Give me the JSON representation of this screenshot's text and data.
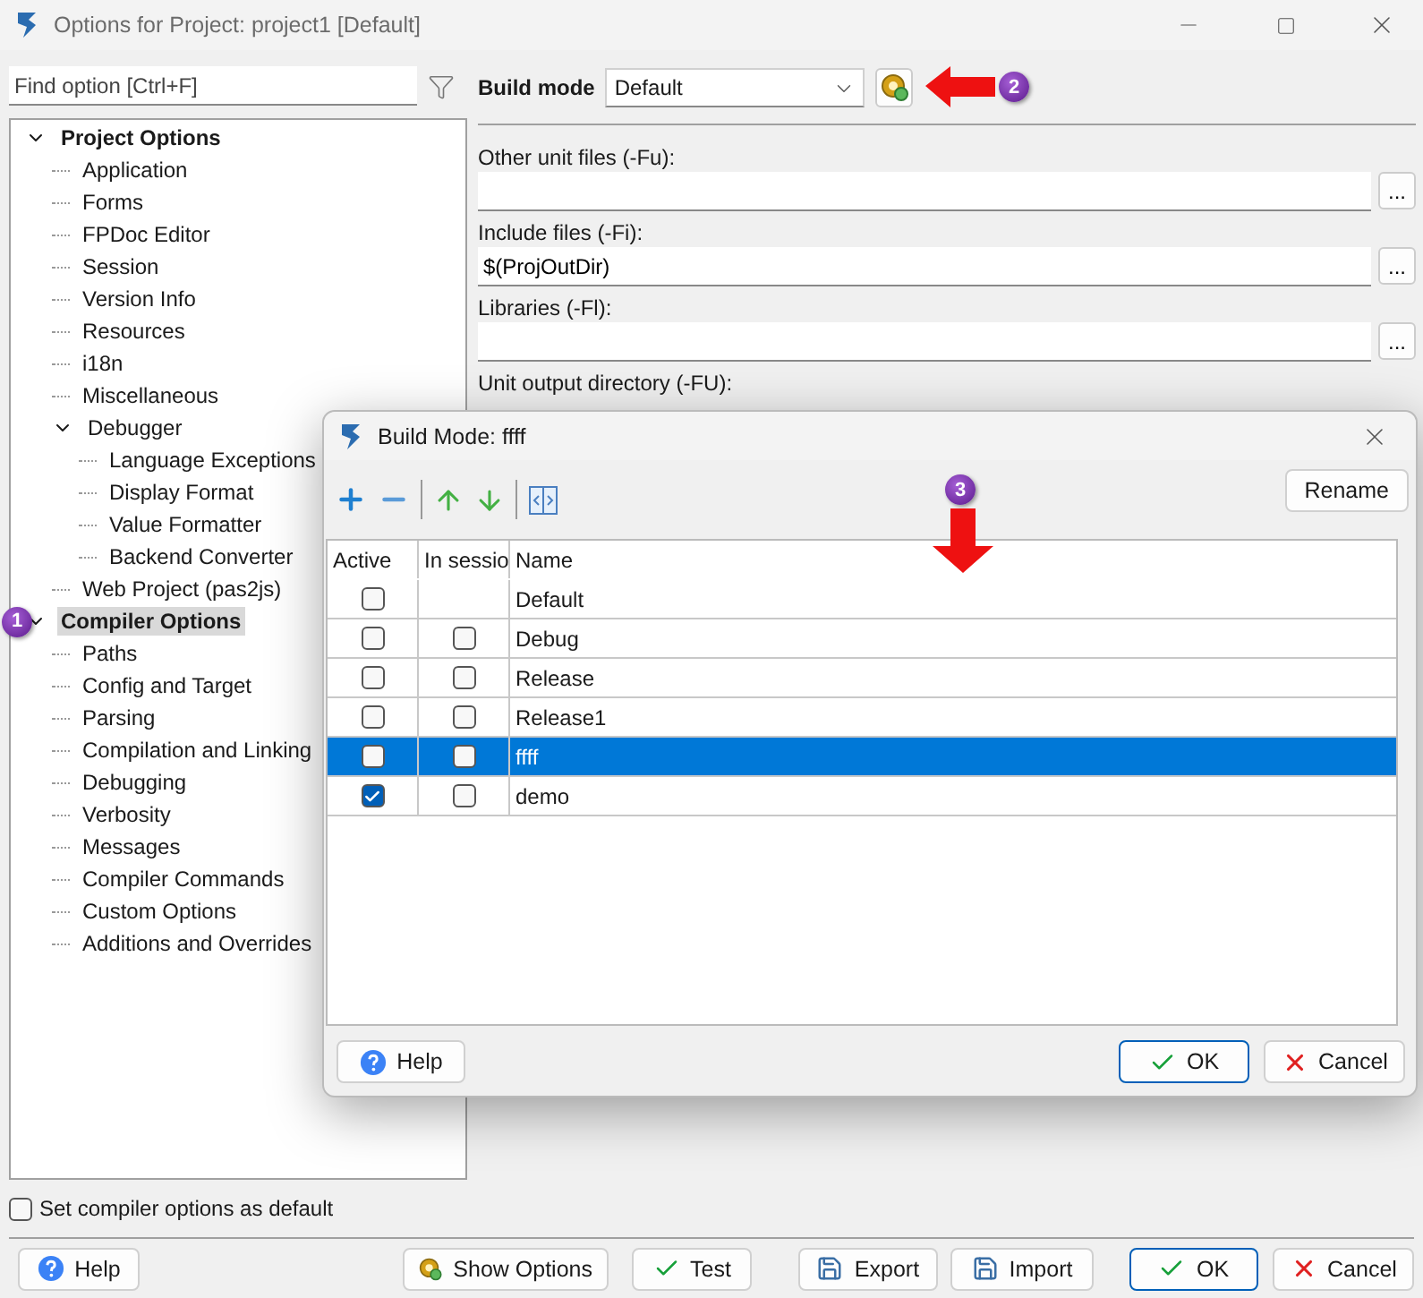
{
  "window": {
    "title": "Options for Project: project1 [Default]"
  },
  "search": {
    "placeholder": "Find option [Ctrl+F]"
  },
  "tree": [
    {
      "label": "Project Options",
      "expanded": true,
      "selected": false,
      "children": [
        {
          "label": "Application",
          "selected": false
        },
        {
          "label": "Forms",
          "selected": false
        },
        {
          "label": "FPDoc Editor",
          "selected": false
        },
        {
          "label": "Session",
          "selected": false
        },
        {
          "label": "Version Info",
          "selected": false
        },
        {
          "label": "Resources",
          "selected": false
        },
        {
          "label": "i18n",
          "selected": false
        },
        {
          "label": "Miscellaneous",
          "selected": false
        },
        {
          "label": "Debugger",
          "expanded": true,
          "selected": false,
          "children": [
            {
              "label": "Language Exceptions",
              "selected": false
            },
            {
              "label": "Display Format",
              "selected": false
            },
            {
              "label": "Value Formatter",
              "selected": false
            },
            {
              "label": "Backend Converter",
              "selected": false
            }
          ]
        },
        {
          "label": "Web Project (pas2js)",
          "selected": false
        }
      ]
    },
    {
      "label": "Compiler Options",
      "expanded": true,
      "selected": true,
      "marker": "1",
      "children": [
        {
          "label": "Paths",
          "selected": false
        },
        {
          "label": "Config and Target",
          "selected": false
        },
        {
          "label": "Parsing",
          "selected": false
        },
        {
          "label": "Compilation and Linking",
          "selected": false
        },
        {
          "label": "Debugging",
          "selected": false
        },
        {
          "label": "Verbosity",
          "selected": false
        },
        {
          "label": "Messages",
          "selected": false
        },
        {
          "label": "Compiler Commands",
          "selected": false
        },
        {
          "label": "Custom Options",
          "selected": false
        },
        {
          "label": "Additions and Overrides",
          "selected": false
        }
      ]
    }
  ],
  "build_mode": {
    "label": "Build mode",
    "value": "Default",
    "marker": "2"
  },
  "fields": [
    {
      "label": "Other unit files (-Fu):",
      "button": "..."
    },
    {
      "label": "Include files (-Fi):",
      "value": "$(ProjOutDir)",
      "button": "..."
    },
    {
      "label": "Libraries (-Fl):",
      "button": "..."
    }
  ],
  "next_label": "Unit output directory (-FU):",
  "default_checkbox": {
    "label": "Set compiler options as default",
    "checked": false
  },
  "buttons": [
    {
      "label": "Help",
      "kind": "help"
    },
    {
      "label": "Show Options",
      "kind": "gear"
    },
    {
      "label": "Test",
      "kind": "check"
    },
    {
      "label": "Export",
      "kind": "save"
    },
    {
      "label": "Import",
      "kind": "save"
    },
    {
      "label": "OK",
      "kind": "ok"
    },
    {
      "label": "Cancel",
      "kind": "cancel"
    }
  ],
  "dialog": {
    "title": "Build Mode: ffff",
    "marker": "3",
    "rename": "Rename",
    "columns": [
      "Active",
      "In sessio",
      "Name"
    ],
    "rows": [
      {
        "active": false,
        "name": "Default",
        "selected": false
      },
      {
        "active": false,
        "in_session": false,
        "name": "Debug",
        "selected": false
      },
      {
        "active": false,
        "in_session": false,
        "name": "Release",
        "selected": false
      },
      {
        "active": false,
        "in_session": false,
        "name": "Release1",
        "selected": false
      },
      {
        "active": false,
        "in_session": false,
        "name": "ffff",
        "selected": true
      },
      {
        "active": true,
        "in_session": false,
        "name": "demo",
        "selected": false
      }
    ],
    "buttons": [
      {
        "label": "Help",
        "kind": "help"
      },
      {
        "label": "OK",
        "kind": "ok"
      },
      {
        "label": "Cancel",
        "kind": "cancel"
      }
    ]
  }
}
